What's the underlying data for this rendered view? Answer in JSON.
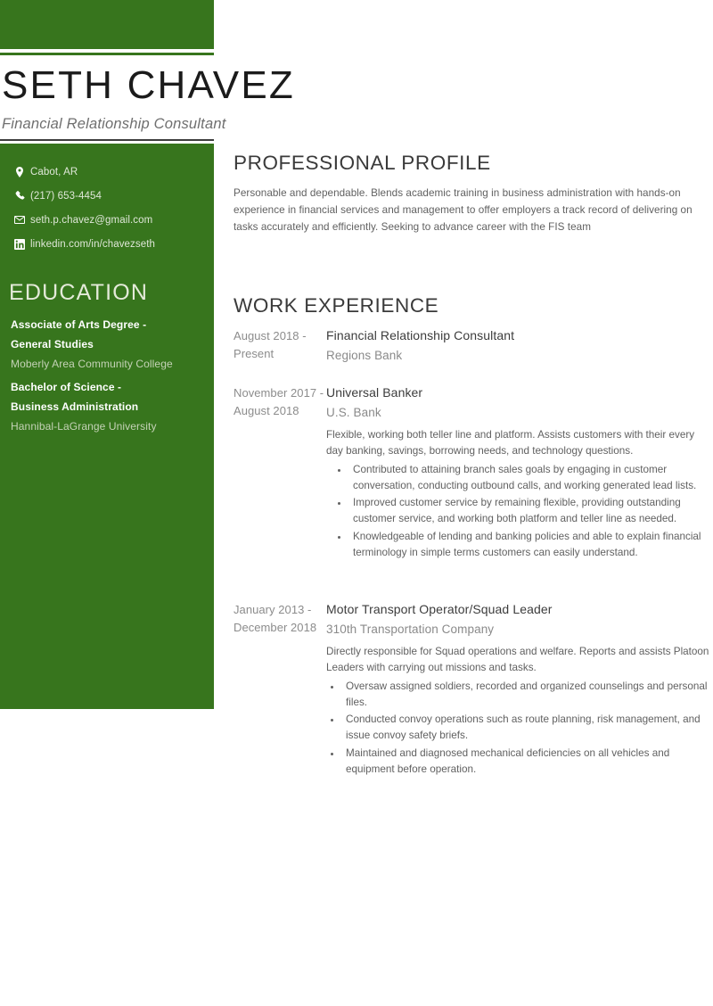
{
  "theme": {
    "accent_green": "#37751d",
    "name_color": "#1b1b1b",
    "body_text_color": "#616161"
  },
  "header": {
    "name": "SETH CHAVEZ",
    "title": "Financial Relationship Consultant"
  },
  "sidebar": {
    "contact": [
      {
        "icon": "map-pin-icon",
        "text": "Cabot, AR"
      },
      {
        "icon": "phone-icon",
        "text": "(217) 653-4454"
      },
      {
        "icon": "envelope-icon",
        "text": "seth.p.chavez@gmail.com"
      },
      {
        "icon": "linkedin-icon",
        "text": "linkedin.com/in/chavezseth"
      }
    ],
    "education_heading": "EDUCATION",
    "education": [
      {
        "degree_line_1": "Associate of Arts Degree -",
        "degree_line_2": "General Studies",
        "school": "Moberly Area Community College"
      },
      {
        "degree_line_1": "Bachelor of Science -",
        "degree_line_2": "Business Administration",
        "school": "Hannibal-LaGrange University"
      }
    ]
  },
  "main": {
    "profile": {
      "heading": "PROFESSIONAL PROFILE",
      "text": "Personable and dependable. Blends academic training in business administration with hands-on experience in financial services and management to offer employers a track record of delivering on tasks accurately and efficiently. Seeking to advance career with the FIS team"
    },
    "work": {
      "heading": "WORK EXPERIENCE",
      "jobs": [
        {
          "dates": "August 2018 - Present",
          "role": "Financial Relationship Consultant",
          "company": "Regions Bank",
          "summary": "",
          "bullets": []
        },
        {
          "dates": "November 2017 - August 2018",
          "role": "Universal Banker",
          "company": "U.S. Bank",
          "summary": "Flexible, working both teller line and platform. Assists customers with their every day banking, savings, borrowing needs, and technology questions.",
          "bullets": [
            "Contributed to attaining branch sales goals by engaging in customer conversation, conducting outbound calls, and working generated lead lists.",
            "Improved customer service by remaining flexible, providing outstanding customer service, and working both platform and teller line as needed.",
            "Knowledgeable of lending and banking policies and able to explain financial terminology in simple terms customers can easily understand."
          ]
        },
        {
          "dates": "January 2013 - December 2018",
          "role": "Motor Transport Operator/Squad Leader",
          "company": "310th Transportation Company",
          "summary": "Directly responsible for Squad operations and welfare. Reports and assists Platoon Leaders with carrying out missions and tasks.",
          "bullets": [
            " Oversaw assigned soldiers, recorded and organized counselings and personal files.",
            "Conducted convoy operations such as route planning, risk management, and issue convoy safety briefs.",
            "Maintained and diagnosed mechanical deficiencies on all vehicles and equipment before operation."
          ]
        }
      ]
    }
  }
}
